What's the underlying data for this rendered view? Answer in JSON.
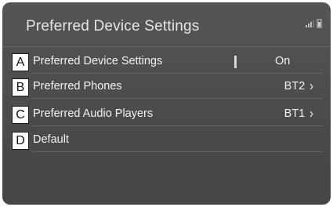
{
  "header": {
    "title": "Preferred Device Settings"
  },
  "status_icons": [
    "signal-icon",
    "battery-icon"
  ],
  "rows": [
    {
      "badge": "A",
      "label": "Preferred Device Settings",
      "value": "On"
    },
    {
      "badge": "B",
      "label": "Preferred Phones",
      "value": "BT2"
    },
    {
      "badge": "C",
      "label": "Preferred Audio Players",
      "value": "BT1"
    },
    {
      "badge": "D",
      "label": "Default",
      "value": ""
    }
  ],
  "chevron": "›"
}
